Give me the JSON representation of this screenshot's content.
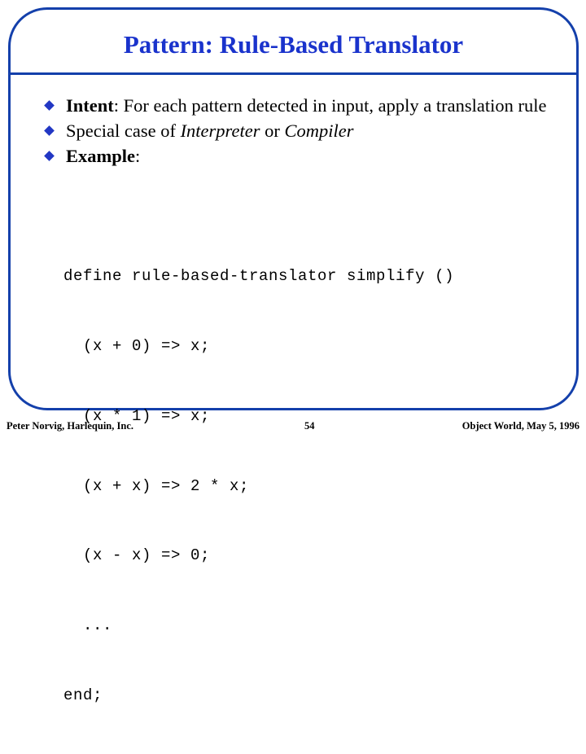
{
  "slide": {
    "title": "Pattern: Rule-Based Translator",
    "accent_color": "#1440ab",
    "title_color": "#1a33cc",
    "bullet_color": "#2237c4",
    "text_color": "#000000",
    "background_color": "#ffffff"
  },
  "bullets": [
    {
      "marker": "diamond-bullet-icon",
      "parts": [
        {
          "text": "Intent",
          "style": "bold"
        },
        {
          "text": ": For each pattern detected in input, apply a translation rule",
          "style": "normal"
        }
      ],
      "bold_lead": "Intent",
      "rest": ": For each pattern detected in input, apply a translation rule"
    },
    {
      "marker": "diamond-bullet-icon",
      "lead": "Special case of ",
      "italic_1": "Interpreter",
      "conjunction": " or ",
      "italic_2": "Compiler"
    },
    {
      "marker": "diamond-bullet-icon",
      "bold_lead": "Example",
      "rest": ":"
    }
  ],
  "code": {
    "language": "dylan",
    "lines": [
      "define rule-based-translator simplify ()",
      "  (x + 0) => x;",
      "  (x * 1) => x;",
      "  (x + x) => 2 * x;",
      "  (x - x) => 0;",
      "  ...",
      "end;"
    ]
  },
  "footer": {
    "left": "Peter Norvig, Harlequin, Inc.",
    "page_number": "54",
    "right": "Object World, May 5, 1996"
  }
}
